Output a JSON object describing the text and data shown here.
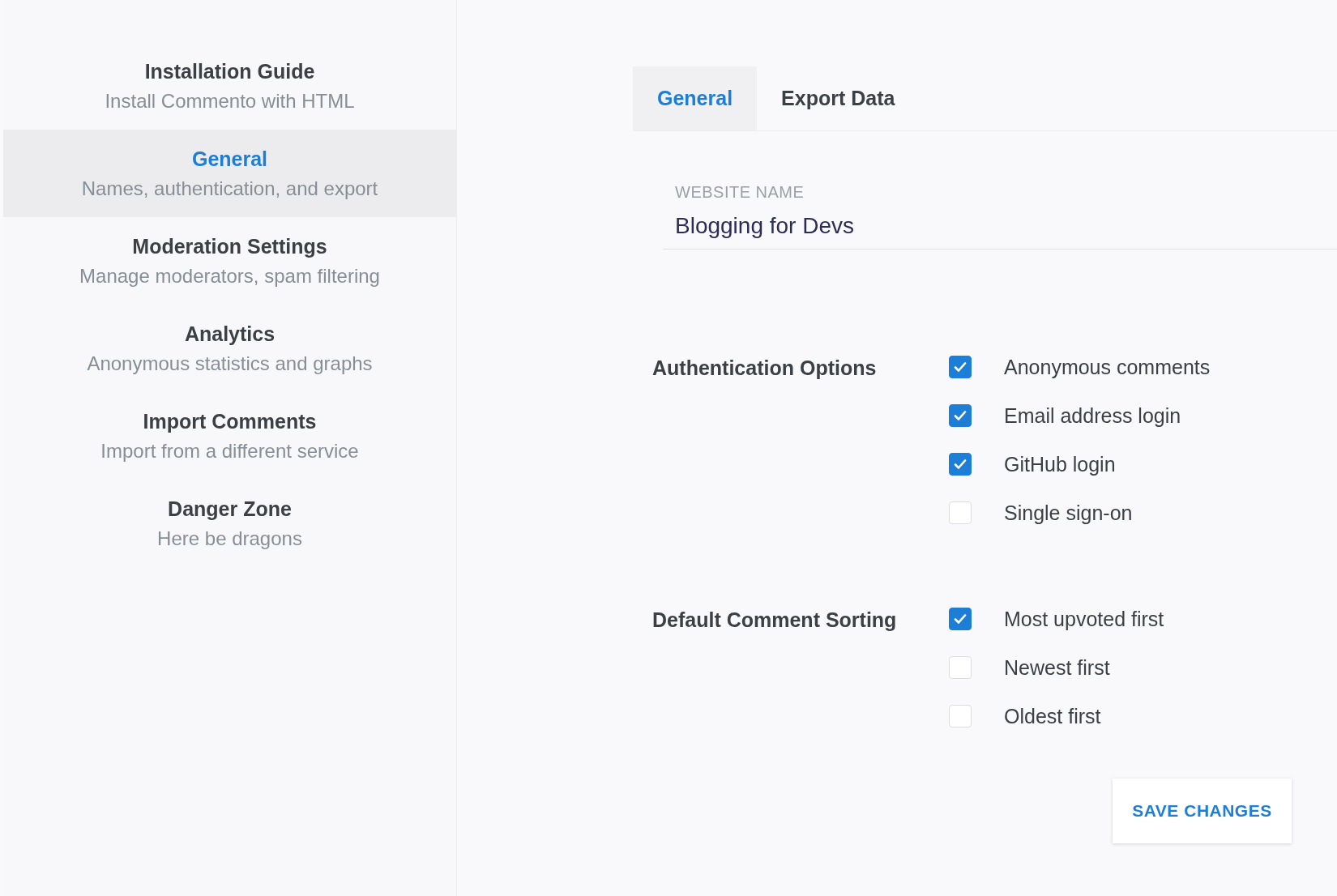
{
  "sidebar": {
    "items": [
      {
        "title": "Installation Guide",
        "subtitle": "Install Commento with HTML",
        "selected": false
      },
      {
        "title": "General",
        "subtitle": "Names, authentication, and export",
        "selected": true
      },
      {
        "title": "Moderation Settings",
        "subtitle": "Manage moderators, spam filtering",
        "selected": false
      },
      {
        "title": "Analytics",
        "subtitle": "Anonymous statistics and graphs",
        "selected": false
      },
      {
        "title": "Import Comments",
        "subtitle": "Import from a different service",
        "selected": false
      },
      {
        "title": "Danger Zone",
        "subtitle": "Here be dragons",
        "selected": false
      }
    ]
  },
  "tabs": [
    {
      "label": "General",
      "selected": true
    },
    {
      "label": "Export Data",
      "selected": false
    }
  ],
  "website_name": {
    "label": "WEBSITE NAME",
    "value": "Blogging for Devs"
  },
  "option_groups": [
    {
      "label": "Authentication Options",
      "options": [
        {
          "label": "Anonymous comments",
          "checked": true
        },
        {
          "label": "Email address login",
          "checked": true
        },
        {
          "label": "GitHub login",
          "checked": true
        },
        {
          "label": "Single sign-on",
          "checked": false
        }
      ]
    },
    {
      "label": "Default Comment Sorting",
      "options": [
        {
          "label": "Most upvoted first",
          "checked": true
        },
        {
          "label": "Newest first",
          "checked": false
        },
        {
          "label": "Oldest first",
          "checked": false
        }
      ]
    }
  ],
  "save_button": "SAVE CHANGES"
}
